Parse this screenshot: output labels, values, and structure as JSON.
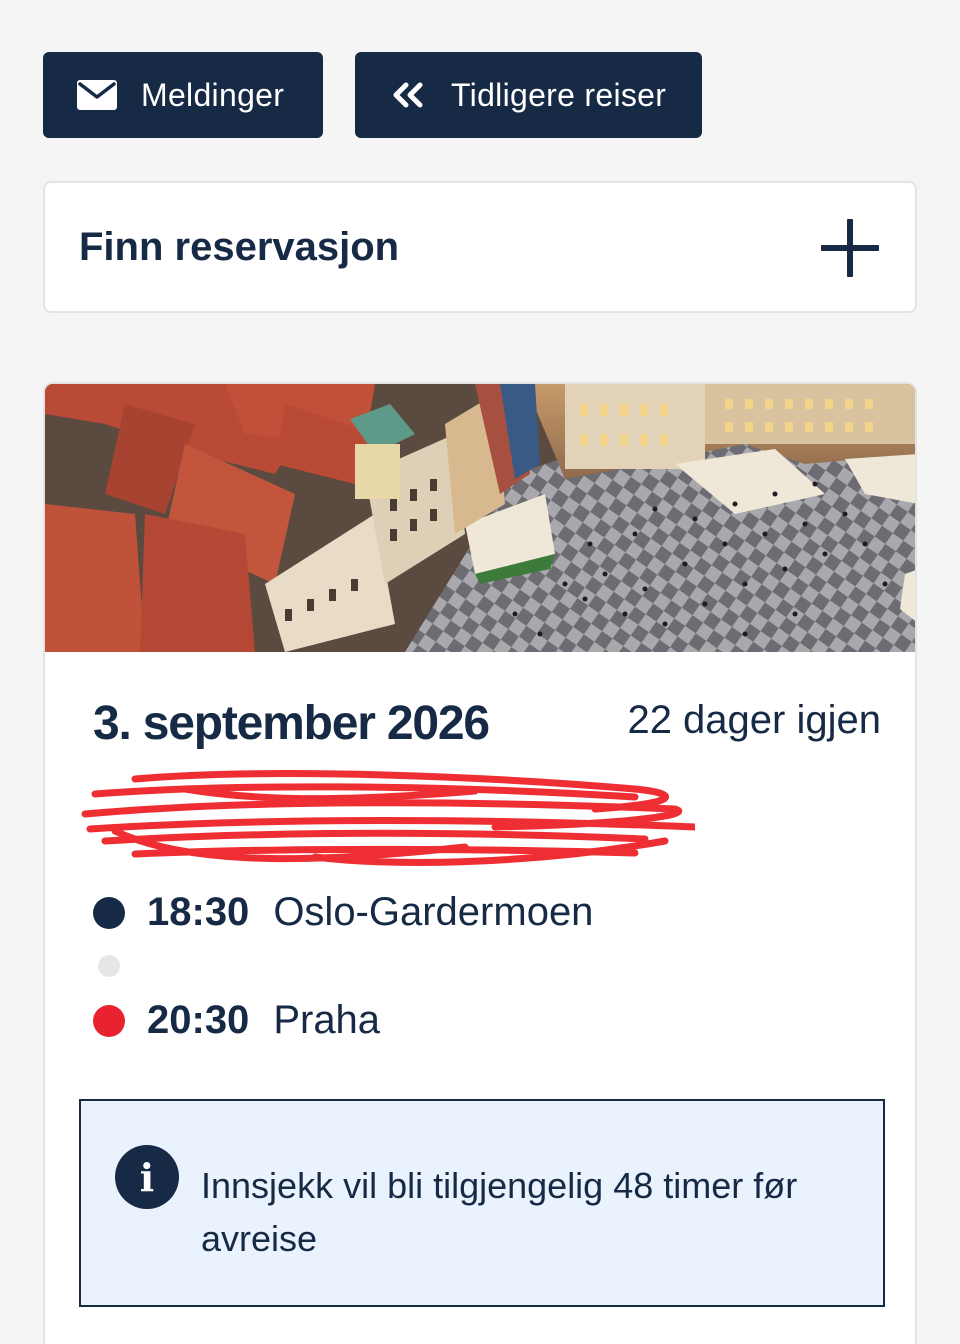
{
  "toolbar": {
    "messages_label": "Meldinger",
    "messages_icon": "envelope-icon",
    "previous_trips_label": "Tidligere reiser",
    "previous_trips_icon": "double-chevron-left-icon"
  },
  "find_reservation": {
    "title": "Finn reservasjon",
    "action_icon": "plus-icon"
  },
  "trip": {
    "image_icon": "prague-old-town-square-photo",
    "date": "3. september 2026",
    "days_left": "22 dager igjen",
    "departure": {
      "time": "18:30",
      "place": "Oslo-Gardermoen",
      "dot_color": "#172a45"
    },
    "arrival": {
      "time": "20:30",
      "place": "Praha",
      "dot_color": "#e8232f"
    },
    "info": {
      "icon": "info-icon",
      "text": "Innsjekk vil bli tilgjengelig 48 timer før avreise"
    }
  },
  "colors": {
    "brand_navy": "#172a45",
    "accent_red": "#e8232f",
    "info_bg": "#e9f2fd",
    "page_bg": "#f5f5f5"
  }
}
